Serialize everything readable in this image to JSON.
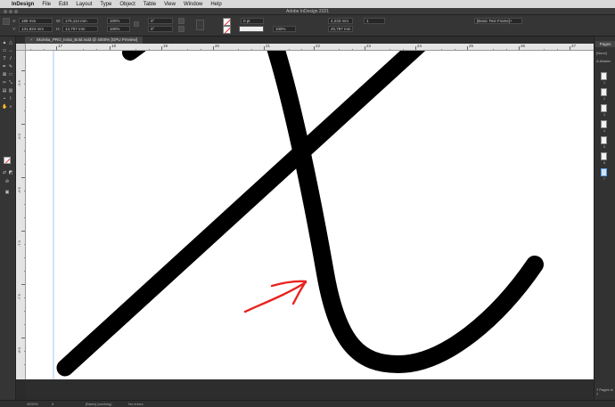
{
  "menubar": {
    "apple": "",
    "app": "InDesign",
    "items": [
      "File",
      "Edit",
      "Layout",
      "Type",
      "Object",
      "Table",
      "View",
      "Window",
      "Help"
    ]
  },
  "window": {
    "title": "Adobe InDesign 2021"
  },
  "control": {
    "x_value": "185 mm",
    "y_value": "131,924 mm",
    "w_value": "170,114 mm",
    "h_value": "14,707 mm",
    "scale_x": "100%",
    "scale_y": "100%",
    "rotate": "0°",
    "shear": "0°",
    "stroke_weight": "0 pt",
    "opacity": "100%",
    "ref_w": "4,233 mm",
    "ref_h": "20,787 mm",
    "columns": "1",
    "frame_style": "[Basic Text Frame]+"
  },
  "document": {
    "tab_label": "Skolska_PRO_Isnta_Bold.indd @ 4000% [GPU Preview]",
    "close": "×"
  },
  "ruler": {
    "h_labels": [
      "17",
      "18",
      "19",
      "20",
      "21",
      "22",
      "23",
      "24",
      "25",
      "26",
      "27"
    ],
    "v_labels": [
      "-5 5",
      "-6 0",
      "-6 5",
      "-7 0",
      "-7 5",
      "-8 0"
    ]
  },
  "pages_panel": {
    "tab": "Pages",
    "none_label": "[None]",
    "master_label": "A-Master",
    "page_numbers": [
      "1",
      "2",
      "3",
      "4",
      "5",
      "6",
      "7"
    ],
    "footer": "7 Pages in 7"
  },
  "status": {
    "zoom": "4000%",
    "page": "6",
    "preset": "[Basic] (working)",
    "errors": "No errors"
  },
  "colors": {
    "glyph": "#000000",
    "annotation_arrow": "#e8231f",
    "selection": "#5aa0e6"
  }
}
